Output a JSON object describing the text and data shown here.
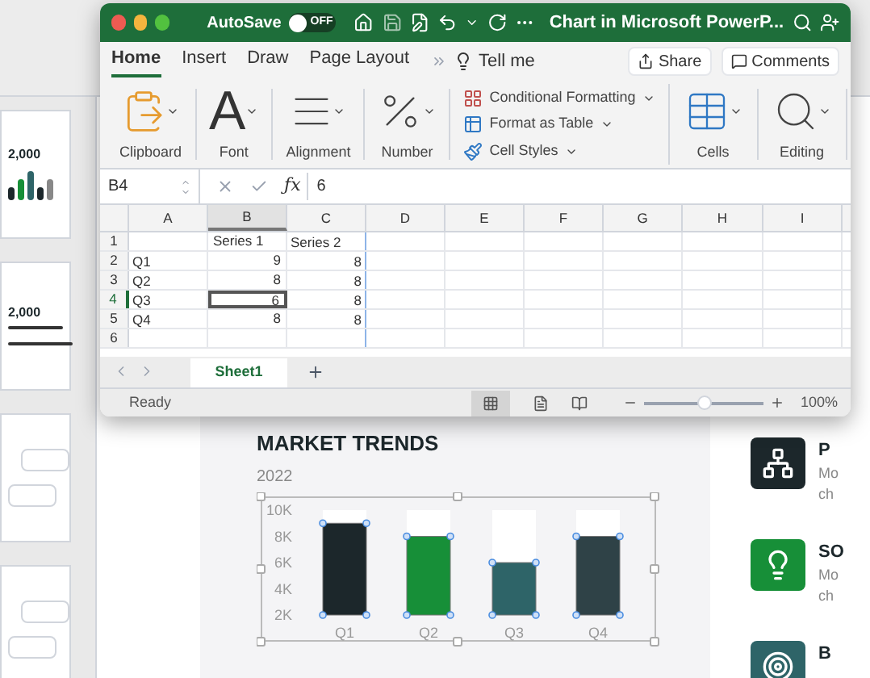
{
  "excel": {
    "title_bar": {
      "autosave_label": "AutoSave",
      "autosave_toggle": {
        "label": "OFF",
        "on": false
      },
      "title": "Chart in Microsoft PowerP..."
    },
    "ribbon_tabs": [
      {
        "label": "Home",
        "selected": true
      },
      {
        "label": "Insert",
        "selected": false
      },
      {
        "label": "Draw",
        "selected": false
      },
      {
        "label": "Page Layout",
        "selected": false
      }
    ],
    "tell_me": "Tell me",
    "share": "Share",
    "comments": "Comments",
    "ribbon_groups": [
      {
        "label": "Clipboard",
        "kind": "clipboard"
      },
      {
        "label": "Font",
        "kind": "font",
        "glyph": "A"
      },
      {
        "label": "Alignment",
        "kind": "alignment"
      },
      {
        "label": "Number",
        "kind": "number"
      }
    ],
    "styles_commands": [
      {
        "label": "Conditional Formatting",
        "kind": "conditional"
      },
      {
        "label": "Format as Table",
        "kind": "table"
      },
      {
        "label": "Cell Styles",
        "kind": "styles"
      }
    ],
    "ribbon_groups_right": [
      {
        "label": "Cells",
        "kind": "cells"
      },
      {
        "label": "Editing",
        "kind": "editing"
      }
    ],
    "name_box": "B4",
    "function_label": "ƒx",
    "formula_value": "6",
    "columns": [
      {
        "label": "A",
        "selected": false
      },
      {
        "label": "B",
        "selected": true
      },
      {
        "label": "C",
        "selected": false
      },
      {
        "label": "D",
        "selected": false
      },
      {
        "label": "E",
        "selected": false
      },
      {
        "label": "F",
        "selected": false
      },
      {
        "label": "G",
        "selected": false
      },
      {
        "label": "H",
        "selected": false
      },
      {
        "label": "I",
        "selected": false
      }
    ],
    "rows": [
      {
        "number": "1",
        "selected": false,
        "series_1": "Series 1",
        "series_2": "Series 2"
      },
      {
        "number": "2",
        "selected": false,
        "label": "Q1",
        "series_1": "9",
        "series_2": "8"
      },
      {
        "number": "3",
        "selected": false,
        "label": "Q2",
        "series_1": "8",
        "series_2": "8"
      },
      {
        "number": "4",
        "selected": true,
        "label": "Q3",
        "series_1": "6",
        "series_2": "8"
      },
      {
        "number": "5",
        "selected": false,
        "label": "Q4",
        "series_1": "8",
        "series_2": "8"
      },
      {
        "number": "6",
        "selected": false
      }
    ],
    "sheet_tabs": [
      {
        "label": "Sheet1",
        "selected": true
      }
    ],
    "status": "Ready",
    "zoom": {
      "level": 0.5,
      "reading": "100%"
    }
  },
  "slide_thumbnails": [
    {
      "kind": "bars",
      "figure": "2,000"
    },
    {
      "kind": "timeline",
      "figure": "2,000"
    },
    {
      "kind": "cards"
    },
    {
      "kind": "cards"
    }
  ],
  "slide": {
    "title": "MARKET TRENDS",
    "year": "2022",
    "chart_data": {
      "type": "bar",
      "categories": [
        "Q1",
        "Q2",
        "Q3",
        "Q4"
      ],
      "ylim": [
        2000,
        10000
      ],
      "yticks": [
        {
          "value": 10000,
          "label": "10K"
        },
        {
          "value": 8000,
          "label": "8K"
        },
        {
          "value": 6000,
          "label": "6K"
        },
        {
          "value": 4000,
          "label": "4K"
        },
        {
          "value": 2000,
          "label": "2K"
        }
      ],
      "series": [
        {
          "color": "#1c272b",
          "values": [
            9000,
            null,
            null,
            null
          ]
        },
        {
          "color": "#178f38",
          "values": [
            null,
            8000,
            null,
            null
          ]
        },
        {
          "color": "#2e6468",
          "values": [
            null,
            null,
            6000,
            null
          ]
        },
        {
          "color": "#2f4247",
          "values": [
            null,
            null,
            null,
            8000
          ]
        }
      ]
    },
    "features": [
      {
        "heading": "P",
        "lines": [
          "Mo",
          "ch"
        ],
        "color": "#1c272b",
        "kind": "network"
      },
      {
        "heading": "SO",
        "lines": [
          "Mo",
          "ch"
        ],
        "color": "#178f38",
        "kind": "idea"
      },
      {
        "heading": "B",
        "color": "#2e6468",
        "kind": "target"
      }
    ]
  }
}
